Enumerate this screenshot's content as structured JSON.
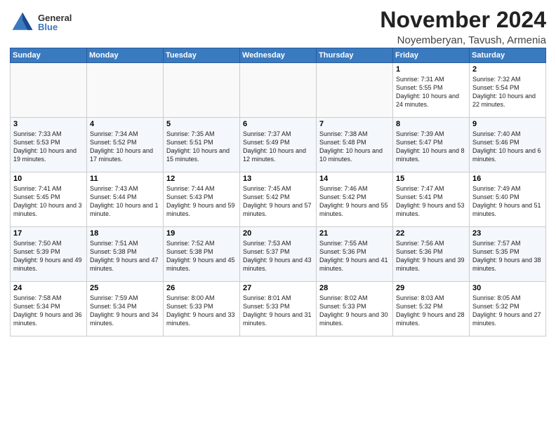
{
  "header": {
    "logo_general": "General",
    "logo_blue": "Blue",
    "month_title": "November 2024",
    "location": "Noyemberyan, Tavush, Armenia"
  },
  "days_of_week": [
    "Sunday",
    "Monday",
    "Tuesday",
    "Wednesday",
    "Thursday",
    "Friday",
    "Saturday"
  ],
  "weeks": [
    [
      {
        "day": "",
        "info": ""
      },
      {
        "day": "",
        "info": ""
      },
      {
        "day": "",
        "info": ""
      },
      {
        "day": "",
        "info": ""
      },
      {
        "day": "",
        "info": ""
      },
      {
        "day": "1",
        "info": "Sunrise: 7:31 AM\nSunset: 5:55 PM\nDaylight: 10 hours and 24 minutes."
      },
      {
        "day": "2",
        "info": "Sunrise: 7:32 AM\nSunset: 5:54 PM\nDaylight: 10 hours and 22 minutes."
      }
    ],
    [
      {
        "day": "3",
        "info": "Sunrise: 7:33 AM\nSunset: 5:53 PM\nDaylight: 10 hours and 19 minutes."
      },
      {
        "day": "4",
        "info": "Sunrise: 7:34 AM\nSunset: 5:52 PM\nDaylight: 10 hours and 17 minutes."
      },
      {
        "day": "5",
        "info": "Sunrise: 7:35 AM\nSunset: 5:51 PM\nDaylight: 10 hours and 15 minutes."
      },
      {
        "day": "6",
        "info": "Sunrise: 7:37 AM\nSunset: 5:49 PM\nDaylight: 10 hours and 12 minutes."
      },
      {
        "day": "7",
        "info": "Sunrise: 7:38 AM\nSunset: 5:48 PM\nDaylight: 10 hours and 10 minutes."
      },
      {
        "day": "8",
        "info": "Sunrise: 7:39 AM\nSunset: 5:47 PM\nDaylight: 10 hours and 8 minutes."
      },
      {
        "day": "9",
        "info": "Sunrise: 7:40 AM\nSunset: 5:46 PM\nDaylight: 10 hours and 6 minutes."
      }
    ],
    [
      {
        "day": "10",
        "info": "Sunrise: 7:41 AM\nSunset: 5:45 PM\nDaylight: 10 hours and 3 minutes."
      },
      {
        "day": "11",
        "info": "Sunrise: 7:43 AM\nSunset: 5:44 PM\nDaylight: 10 hours and 1 minute."
      },
      {
        "day": "12",
        "info": "Sunrise: 7:44 AM\nSunset: 5:43 PM\nDaylight: 9 hours and 59 minutes."
      },
      {
        "day": "13",
        "info": "Sunrise: 7:45 AM\nSunset: 5:42 PM\nDaylight: 9 hours and 57 minutes."
      },
      {
        "day": "14",
        "info": "Sunrise: 7:46 AM\nSunset: 5:42 PM\nDaylight: 9 hours and 55 minutes."
      },
      {
        "day": "15",
        "info": "Sunrise: 7:47 AM\nSunset: 5:41 PM\nDaylight: 9 hours and 53 minutes."
      },
      {
        "day": "16",
        "info": "Sunrise: 7:49 AM\nSunset: 5:40 PM\nDaylight: 9 hours and 51 minutes."
      }
    ],
    [
      {
        "day": "17",
        "info": "Sunrise: 7:50 AM\nSunset: 5:39 PM\nDaylight: 9 hours and 49 minutes."
      },
      {
        "day": "18",
        "info": "Sunrise: 7:51 AM\nSunset: 5:38 PM\nDaylight: 9 hours and 47 minutes."
      },
      {
        "day": "19",
        "info": "Sunrise: 7:52 AM\nSunset: 5:38 PM\nDaylight: 9 hours and 45 minutes."
      },
      {
        "day": "20",
        "info": "Sunrise: 7:53 AM\nSunset: 5:37 PM\nDaylight: 9 hours and 43 minutes."
      },
      {
        "day": "21",
        "info": "Sunrise: 7:55 AM\nSunset: 5:36 PM\nDaylight: 9 hours and 41 minutes."
      },
      {
        "day": "22",
        "info": "Sunrise: 7:56 AM\nSunset: 5:36 PM\nDaylight: 9 hours and 39 minutes."
      },
      {
        "day": "23",
        "info": "Sunrise: 7:57 AM\nSunset: 5:35 PM\nDaylight: 9 hours and 38 minutes."
      }
    ],
    [
      {
        "day": "24",
        "info": "Sunrise: 7:58 AM\nSunset: 5:34 PM\nDaylight: 9 hours and 36 minutes."
      },
      {
        "day": "25",
        "info": "Sunrise: 7:59 AM\nSunset: 5:34 PM\nDaylight: 9 hours and 34 minutes."
      },
      {
        "day": "26",
        "info": "Sunrise: 8:00 AM\nSunset: 5:33 PM\nDaylight: 9 hours and 33 minutes."
      },
      {
        "day": "27",
        "info": "Sunrise: 8:01 AM\nSunset: 5:33 PM\nDaylight: 9 hours and 31 minutes."
      },
      {
        "day": "28",
        "info": "Sunrise: 8:02 AM\nSunset: 5:33 PM\nDaylight: 9 hours and 30 minutes."
      },
      {
        "day": "29",
        "info": "Sunrise: 8:03 AM\nSunset: 5:32 PM\nDaylight: 9 hours and 28 minutes."
      },
      {
        "day": "30",
        "info": "Sunrise: 8:05 AM\nSunset: 5:32 PM\nDaylight: 9 hours and 27 minutes."
      }
    ]
  ]
}
